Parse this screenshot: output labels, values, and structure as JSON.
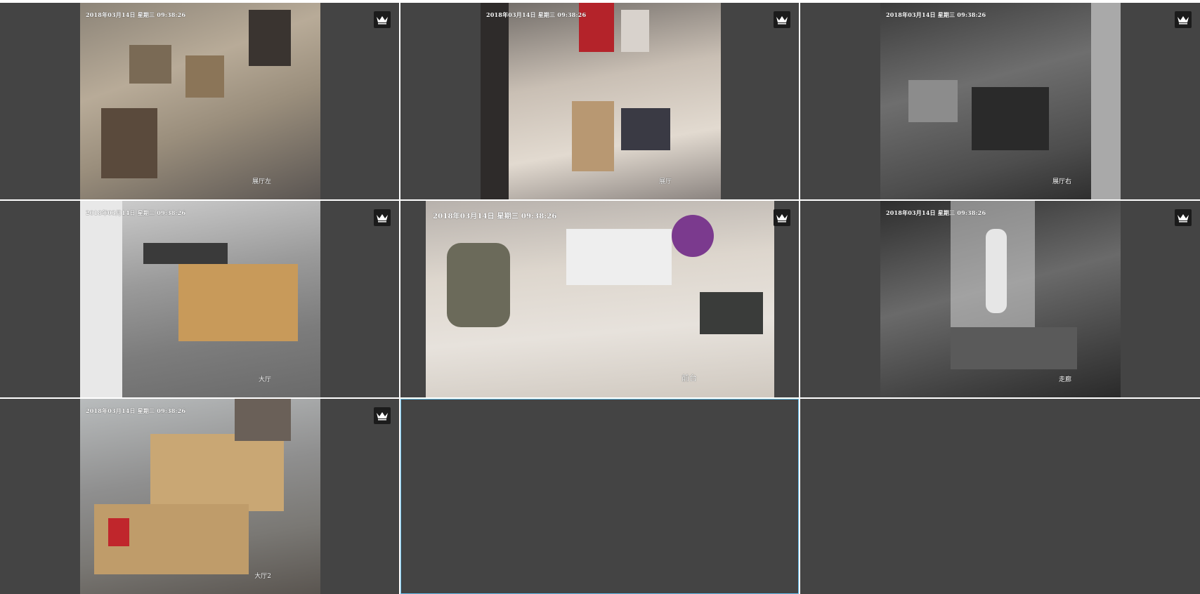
{
  "cameras": [
    {
      "timestamp": "2018年03月14日  星期三  09:38:26",
      "name": "展厅左",
      "slot": 1
    },
    {
      "timestamp": "2018年03月14日  星期三  09:38:26",
      "name": "展厅",
      "slot": 2
    },
    {
      "timestamp": "2018年03月14日  星期三  09:38:26",
      "name": "展厅右",
      "slot": 3
    },
    {
      "timestamp": "2018年03月14日  星期三  09:38:26",
      "name": "大厅",
      "slot": 4
    },
    {
      "timestamp": "2018年03月14日  星期三  09:38:26",
      "name": "前台",
      "slot": 5
    },
    {
      "timestamp": "2018年03月14日  星期三  09:38:26",
      "name": "走廊",
      "slot": 6
    },
    {
      "timestamp": "2018年03月14日  星期三  09:38:26",
      "name": "大厅2",
      "slot": 7
    }
  ],
  "empty_slots": [
    8,
    9
  ],
  "selected_slot": 8,
  "icons": {
    "fullscreen": "crown-icon"
  },
  "colors": {
    "cell_background": "#444444",
    "grid_gap": "#ffffff",
    "selected_border": "#5fb9e6",
    "button_background": "#1b1b1b"
  }
}
